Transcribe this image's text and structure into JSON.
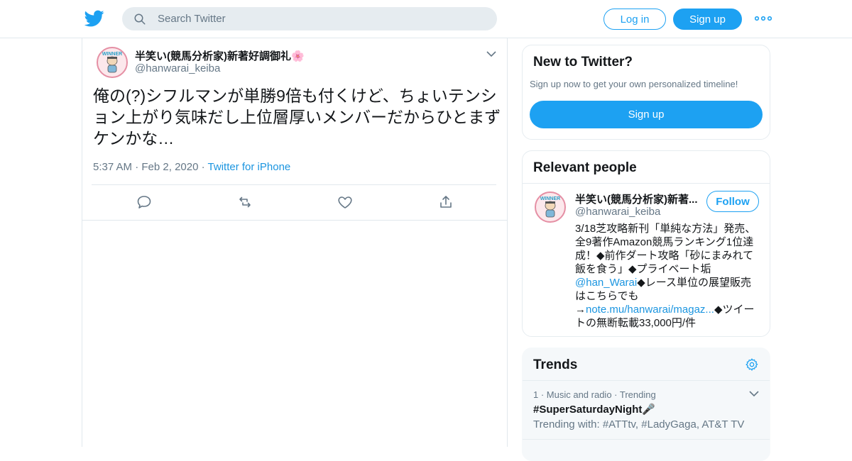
{
  "topbar": {
    "logo_icon": "twitter-bird-icon",
    "search_placeholder": "Search Twitter",
    "login_label": "Log in",
    "signup_label": "Sign up",
    "more_icon": "more-dots-icon",
    "brand_color": "#1da1f2"
  },
  "tweet": {
    "author_name": "半笑い(競馬分析家)新著好調御礼🌸",
    "author_handle": "@hanwarai_keiba",
    "text": "俺の(?)シフルマンが単勝9倍も付くけど、ちょいテンション上がり気味だし上位層厚いメンバーだからひとまずケンかな…",
    "time": "5:37 AM",
    "date": "Feb 2, 2020",
    "source": "Twitter for iPhone",
    "sep": "·",
    "actions": [
      "reply-icon",
      "retweet-icon",
      "like-icon",
      "share-icon"
    ]
  },
  "new_to_twitter": {
    "title": "New to Twitter?",
    "subtitle": "Sign up now to get your own personalized timeline!",
    "signup_label": "Sign up"
  },
  "relevant_people": {
    "title": "Relevant people",
    "person": {
      "name": "半笑い(競馬分析家)新著...",
      "handle": "@hanwarai_keiba",
      "follow_label": "Follow",
      "bio_1": "3/18芝攻略新刊「単純な方法」発売、全9著作Amazon競馬ランキング1位達成！◆前作ダート攻略「砂にまみれて飯を食う」◆プライベート垢",
      "bio_link_1": "@han_Warai",
      "bio_2": "◆レース単位の展望販売はこちらでも→",
      "bio_link_2": "note.mu/hanwarai/magaz...",
      "bio_3": "◆ツイートの無断転載33,000円/件"
    }
  },
  "trends": {
    "title": "Trends",
    "items": [
      {
        "meta": "1 · Music and radio · Trending",
        "name": "#SuperSaturdayNight🎤",
        "with": "Trending with: #ATTtv, #LadyGaga, AT&T TV"
      }
    ]
  }
}
